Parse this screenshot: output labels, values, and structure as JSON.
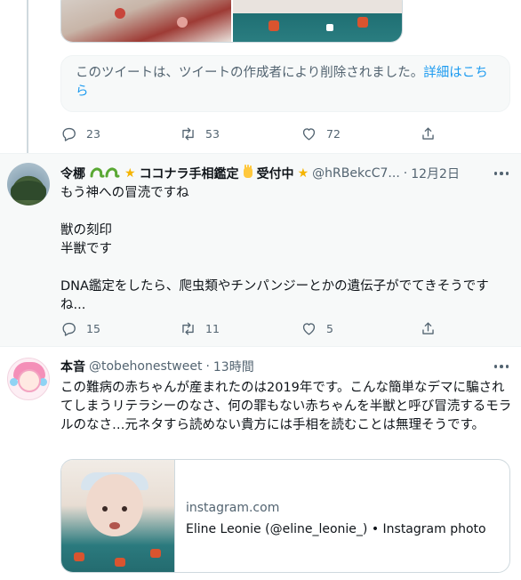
{
  "tweets": [
    {
      "deleted_notice": "このツイートは、ツイートの作成者により削除されました。",
      "deleted_link": "詳細はこちら",
      "stats": {
        "replies": "23",
        "retweets": "53",
        "likes": "72"
      }
    },
    {
      "display_name": "令梛",
      "name_tail": "ココナラ手相鑑定",
      "name_tail2": "受付中",
      "handle": "@hRBekcC7...",
      "separator": "·",
      "date": "12月2日",
      "text": "もう神への冒涜ですね\n\n獣の刻印\n半獣です\n\nDNA鑑定をしたら、爬虫類やチンパンジーとかの遺伝子がでてきそうですね...",
      "stats": {
        "replies": "15",
        "retweets": "11",
        "likes": "5"
      }
    },
    {
      "display_name": "本音",
      "handle": "@tobehonestweet",
      "separator": "·",
      "date": "13時間",
      "text": "この難病の赤ちゃんが産まれたのは2019年です。こんな簡単なデマに騙されてしまうリテラシーのなさ、何の罪もない赤ちゃんを半獣と呼び冒涜するモラルのなさ…元ネタすら読めない貴方には手相を読むことは無理そうです。",
      "card": {
        "domain": "instagram.com",
        "title": "Eline Leonie (@eline_leonie_) • Instagram photo"
      }
    }
  ],
  "icons": {
    "reply": "reply-icon",
    "retweet": "retweet-icon",
    "like": "heart-icon",
    "share": "share-icon",
    "more": "more-icon"
  },
  "colors": {
    "link": "#1d9bf0",
    "muted": "#536471",
    "text": "#0f1419",
    "highlight_bg": "#f7f9f9"
  }
}
